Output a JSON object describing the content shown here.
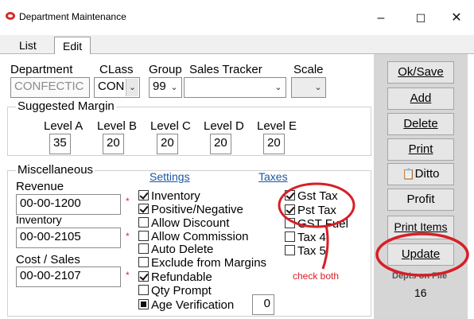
{
  "window": {
    "title": "Department Maintenance",
    "controls": {
      "minimize": "–",
      "maximize": "☐",
      "close": "✕"
    }
  },
  "tabs": [
    {
      "label": "List"
    },
    {
      "label": "Edit"
    }
  ],
  "header": {
    "department_label": "Department",
    "department_value": "CONFECTIC",
    "class_label": "CLass",
    "class_value": "CON",
    "group_label": "Group",
    "group_value": "99",
    "sales_tracker_label": "Sales Tracker",
    "sales_tracker_value": "",
    "scale_label": "Scale",
    "scale_value": ""
  },
  "suggested_margin": {
    "title": "Suggested Margin",
    "levels": [
      {
        "label": "Level A",
        "value": "35"
      },
      {
        "label": "Level B",
        "value": "20"
      },
      {
        "label": "Level C",
        "value": "20"
      },
      {
        "label": "Level D",
        "value": "20"
      },
      {
        "label": "Level E",
        "value": "20"
      }
    ]
  },
  "misc": {
    "title": "Miscellaneous",
    "settings_link": "Settings",
    "taxes_link": "Taxes",
    "required_mark": "*",
    "accounts": [
      {
        "label": "Revenue",
        "value": "00-00-1200"
      },
      {
        "label": "Inventory",
        "value": "00-00-2105"
      },
      {
        "label": "Cost / Sales",
        "value": "00-00-2107"
      }
    ],
    "settings": [
      {
        "label": "Inventory",
        "state": "checked"
      },
      {
        "label": "Positive/Negative",
        "state": "checked"
      },
      {
        "label": "Allow Discount",
        "state": "unchecked"
      },
      {
        "label": "Allow Commission",
        "state": "unchecked"
      },
      {
        "label": "Auto Delete",
        "state": "unchecked"
      },
      {
        "label": "Exclude from Margins",
        "state": "unchecked"
      },
      {
        "label": "Refundable",
        "state": "checked"
      },
      {
        "label": "Qty Prompt",
        "state": "unchecked"
      },
      {
        "label": "Age Verification",
        "state": "filled"
      }
    ],
    "age_verification_value": "0",
    "taxes": [
      {
        "label": "Gst Tax",
        "state": "checked"
      },
      {
        "label": "Pst Tax",
        "state": "checked"
      },
      {
        "label": "GST Fuel",
        "state": "unchecked"
      },
      {
        "label": "Tax 4",
        "state": "unchecked"
      },
      {
        "label": "Tax 5",
        "state": "unchecked"
      }
    ]
  },
  "buttons": {
    "ok_save": "Ok/Save",
    "add": "Add",
    "delete": "Delete",
    "print": "Print",
    "ditto": "Ditto",
    "profit": "Profit",
    "print_items": "Print Items",
    "update": "Update"
  },
  "depts_on_file": {
    "label": "Depts on File",
    "count": "16"
  },
  "annotation": {
    "text": "check both",
    "color": "#d61f26"
  }
}
